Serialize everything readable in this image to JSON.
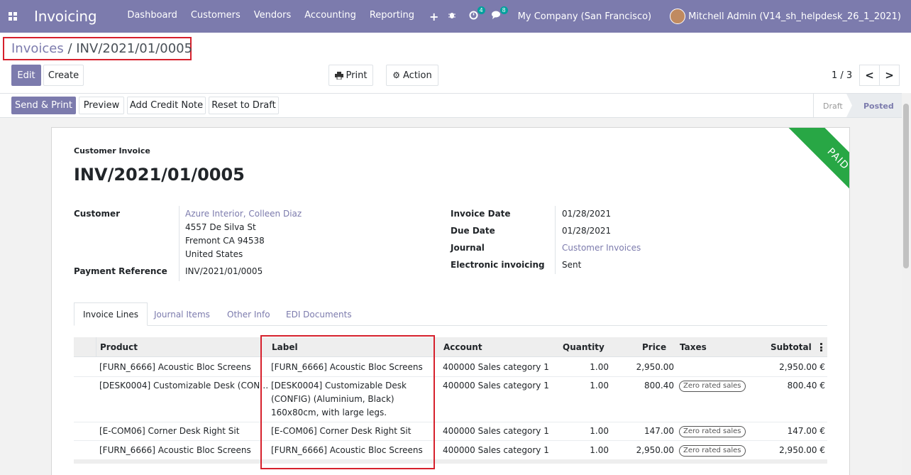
{
  "navbar": {
    "app_name": "Invoicing",
    "menu": [
      "Dashboard",
      "Customers",
      "Vendors",
      "Accounting",
      "Reporting"
    ],
    "plus": "+",
    "activity_badge": "4",
    "messages_badge": "8",
    "company": "My Company (San Francisco)",
    "user": "Mitchell Admin (V14_sh_helpdesk_26_1_2021)"
  },
  "breadcrumb": {
    "parent": "Invoices",
    "separator": " / ",
    "current": "INV/2021/01/0005"
  },
  "buttons": {
    "edit": "Edit",
    "create": "Create",
    "print": "Print",
    "action": "Action",
    "send_print": "Send & Print",
    "preview": "Preview",
    "add_credit_note": "Add Credit Note",
    "reset_draft": "Reset to Draft"
  },
  "pager": {
    "value": "1 / 3",
    "prev": "<",
    "next": ">"
  },
  "stages": {
    "draft": "Draft",
    "posted": "Posted",
    "active": "Posted"
  },
  "ribbon": "PAID",
  "invoice": {
    "type": "Customer Invoice",
    "number": "INV/2021/01/0005",
    "customer_label": "Customer",
    "customer_name": "Azure Interior, Colleen Diaz",
    "address_line1": "4557 De Silva St",
    "address_line2": "Fremont CA 94538",
    "address_line3": "United States",
    "payment_ref_label": "Payment Reference",
    "payment_ref": "INV/2021/01/0005",
    "invoice_date_label": "Invoice Date",
    "invoice_date": "01/28/2021",
    "due_date_label": "Due Date",
    "due_date": "01/28/2021",
    "journal_label": "Journal",
    "journal": "Customer Invoices",
    "edi_label": "Electronic invoicing",
    "edi": "Sent"
  },
  "tabs": [
    "Invoice Lines",
    "Journal Items",
    "Other Info",
    "EDI Documents"
  ],
  "table": {
    "headers": [
      "Product",
      "Label",
      "Account",
      "Quantity",
      "Price",
      "Taxes",
      "Subtotal"
    ],
    "rows": [
      {
        "product": "[FURN_6666] Acoustic Bloc Screens",
        "label_lines": [
          "[FURN_6666] Acoustic Bloc Screens"
        ],
        "account": "400000 Sales category 1",
        "quantity": "1.00",
        "price": "2,950.00",
        "tax": "",
        "subtotal": "2,950.00 €"
      },
      {
        "product": "[DESK0004] Customizable Desk (CON…",
        "label_lines": [
          "[DESK0004] Customizable Desk",
          "(CONFIG) (Aluminium, Black)",
          "160x80cm, with large legs."
        ],
        "account": "400000 Sales category 1",
        "quantity": "1.00",
        "price": "800.40",
        "tax": "Zero rated sales",
        "subtotal": "800.40 €"
      },
      {
        "product": "[E-COM06] Corner Desk Right Sit",
        "label_lines": [
          "[E-COM06] Corner Desk Right Sit"
        ],
        "account": "400000 Sales category 1",
        "quantity": "1.00",
        "price": "147.00",
        "tax": "Zero rated sales",
        "subtotal": "147.00 €"
      },
      {
        "product": "[FURN_6666] Acoustic Bloc Screens",
        "label_lines": [
          "[FURN_6666] Acoustic Bloc Screens"
        ],
        "account": "400000 Sales category 1",
        "quantity": "1.00",
        "price": "2,950.00",
        "tax": "Zero rated sales",
        "subtotal": "2,950.00 €"
      }
    ]
  },
  "colors": {
    "brand": "#7c7bad",
    "paid": "#28a745",
    "highlight": "#d6202c"
  }
}
